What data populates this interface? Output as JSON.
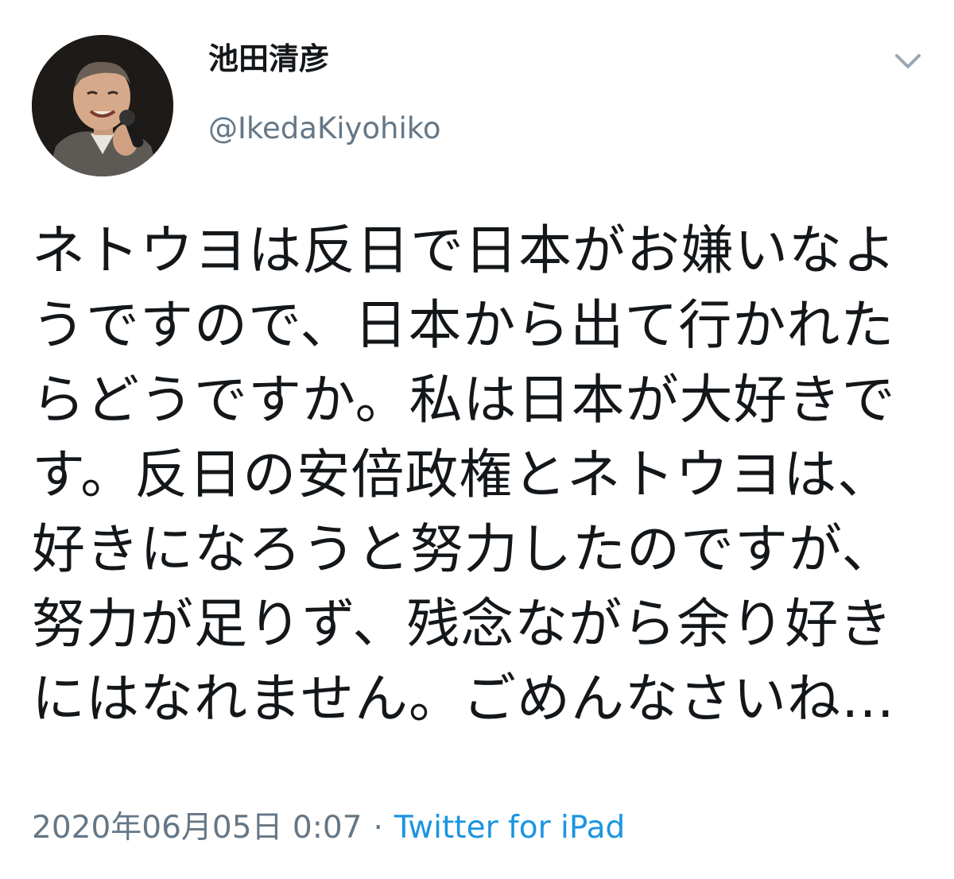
{
  "tweet": {
    "author": {
      "display_name": "池田清彦",
      "handle": "@IkedaKiyohiko",
      "avatar_icon": "profile-photo"
    },
    "menu_icon": "chevron-down-icon",
    "text": "ネトウヨは反日で日本がお嫌いなようですので、日本から出て行かれたらどうですか。私は日本が大好きです。反日の安倍政権とネトウヨは、好きになろうと努力したのですが、努力が足りず、残念ながら余り好きにはなれません。ごめんなさいね…",
    "timestamp": "2020年06月05日 0:07",
    "separator": "·",
    "source": "Twitter for iPad"
  },
  "colors": {
    "text_primary": "#14171a",
    "text_secondary": "#657786",
    "link": "#1b95e0",
    "background": "#ffffff"
  }
}
